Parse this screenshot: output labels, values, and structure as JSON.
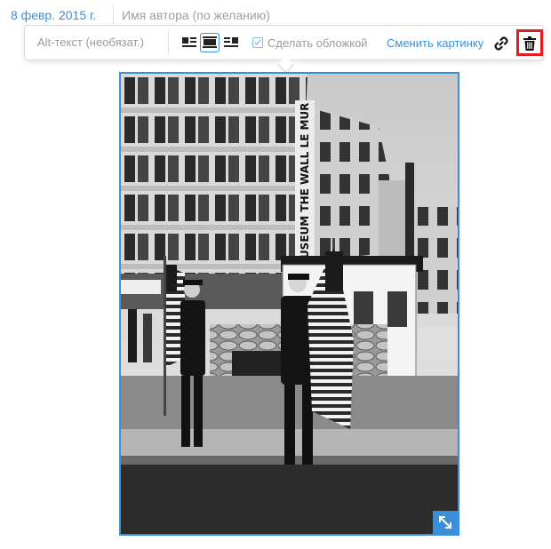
{
  "meta": {
    "date": "8 февр. 2015 г.",
    "author_placeholder": "Имя автора (по желанию)"
  },
  "toolbar": {
    "alt_text_placeholder": "Alt-текст (необязат.)",
    "align_options": [
      {
        "name": "align-left",
        "icon": "align-left-icon",
        "selected": false
      },
      {
        "name": "align-center",
        "icon": "align-center-icon",
        "selected": true
      },
      {
        "name": "align-right",
        "icon": "align-right-icon",
        "selected": false
      }
    ],
    "cover_label": "Сделать обложкой",
    "cover_checked": false,
    "change_image_label": "Сменить картинку",
    "link_icon": "link-icon",
    "delete_icon": "trash-icon",
    "delete_highlight_color": "#e0201e"
  },
  "image": {
    "description_icon": "photo",
    "sign_text": "MUSEUM THE WALL LE MUR",
    "resize_icon": "expand-icon"
  },
  "colors": {
    "accent": "#3b8fd9",
    "muted_text": "#9a9a9a"
  }
}
